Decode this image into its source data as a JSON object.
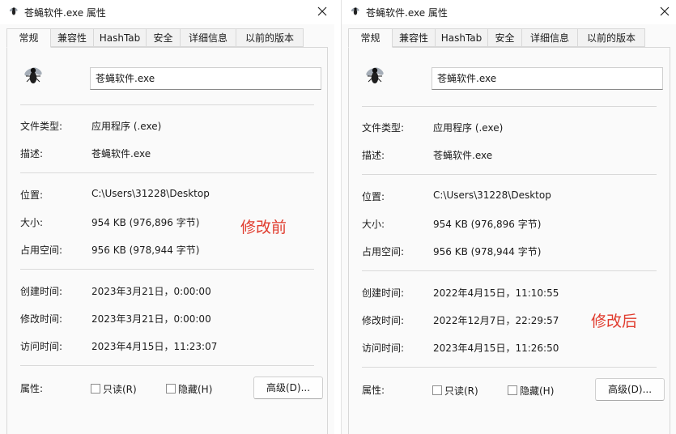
{
  "icons": {
    "title": "fly-app-icon",
    "file": "fly-app-icon",
    "close": "close-icon"
  },
  "colors": {
    "annotation": "#e03a2c"
  },
  "left": {
    "title": "苍蝇软件.exe 属性",
    "tabs": [
      "常规",
      "兼容性",
      "HashTab",
      "安全",
      "详细信息",
      "以前的版本"
    ],
    "file_name": "苍蝇软件.exe",
    "labels": {
      "type": "文件类型:",
      "desc": "描述:",
      "location": "位置:",
      "size": "大小:",
      "size_on_disk": "占用空间:",
      "created": "创建时间:",
      "modified": "修改时间:",
      "accessed": "访问时间:",
      "attributes": "属性:"
    },
    "values": {
      "type": "应用程序 (.exe)",
      "desc": "苍蝇软件.exe",
      "location": "C:\\Users\\31228\\Desktop",
      "size": "954 KB (976,896 字节)",
      "size_on_disk": "956 KB (978,944 字节)",
      "created": "2023年3月21日，0:00:00",
      "modified": "2023年3月21日，0:00:00",
      "accessed": "2023年4月15日，11:23:07"
    },
    "readonly_label": "只读(R)",
    "hidden_label": "隐藏(H)",
    "advanced_label": "高级(D)...",
    "annotation": "修改前"
  },
  "right": {
    "title": "苍蝇软件.exe 属性",
    "tabs": [
      "常规",
      "兼容性",
      "HashTab",
      "安全",
      "详细信息",
      "以前的版本"
    ],
    "file_name": "苍蝇软件.exe",
    "labels": {
      "type": "文件类型:",
      "desc": "描述:",
      "location": "位置:",
      "size": "大小:",
      "size_on_disk": "占用空间:",
      "created": "创建时间:",
      "modified": "修改时间:",
      "accessed": "访问时间:",
      "attributes": "属性:"
    },
    "values": {
      "type": "应用程序 (.exe)",
      "desc": "苍蝇软件.exe",
      "location": "C:\\Users\\31228\\Desktop",
      "size": "954 KB (976,896 字节)",
      "size_on_disk": "956 KB (978,944 字节)",
      "created": "2022年4月15日，11:10:55",
      "modified": "2022年12月7日，22:29:57",
      "accessed": "2023年4月15日，11:26:50"
    },
    "readonly_label": "只读(R)",
    "hidden_label": "隐藏(H)",
    "advanced_label": "高级(D)...",
    "annotation": "修改后"
  }
}
